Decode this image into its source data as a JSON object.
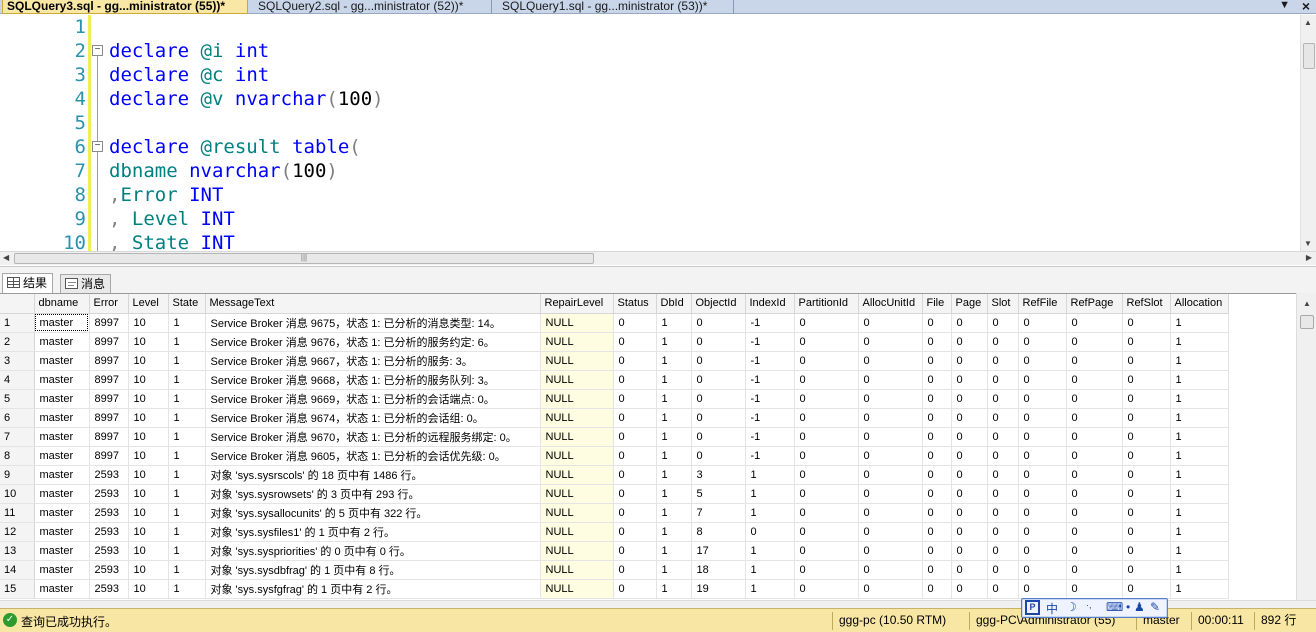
{
  "tabs": [
    {
      "label": "SQLQuery3.sql - gg...ministrator (55))*",
      "active": true
    },
    {
      "label": "SQLQuery2.sql - gg...ministrator (52))*",
      "active": false
    },
    {
      "label": "SQLQuery1.sql - gg...ministrator (53))*",
      "active": false
    }
  ],
  "tabbar": {
    "menu_glyph": "▼",
    "close_glyph": "×"
  },
  "editor": {
    "line_numbers": [
      "1",
      "2",
      "3",
      "4",
      "5",
      "6",
      "7",
      "8",
      "9",
      "10"
    ],
    "code": {
      "l2": {
        "kw": "declare",
        "var": "@i",
        "type": "int"
      },
      "l3": {
        "kw": "declare",
        "var": "@c",
        "type": "int"
      },
      "l4": {
        "kw": "declare",
        "var": "@v",
        "type": "nvarchar",
        "paren_open": "(",
        "num": "100",
        "paren_close": ")"
      },
      "l6": {
        "kw": "declare",
        "var": "@result",
        "type": "table",
        "paren_open": "("
      },
      "l7": {
        "col": "dbname",
        "type": "nvarchar",
        "paren_open": "(",
        "num": "100",
        "paren_close": ")"
      },
      "l8": {
        "comma": ",",
        "col": "Error",
        "type": "INT"
      },
      "l9": {
        "comma": ",",
        "col": " Level",
        "type": "INT"
      },
      "l10": {
        "comma": ",",
        "col": " State",
        "type": "INT"
      }
    },
    "fold_glyph": "−"
  },
  "results_tabs": [
    {
      "label": "结果",
      "active": true
    },
    {
      "label": "消息",
      "active": false
    }
  ],
  "grid": {
    "columns": [
      "dbname",
      "Error",
      "Level",
      "State",
      "MessageText",
      "RepairLevel",
      "Status",
      "DbId",
      "ObjectId",
      "IndexId",
      "PartitionId",
      "AllocUnitId",
      "File",
      "Page",
      "Slot",
      "RefFile",
      "RefPage",
      "RefSlot",
      "Allocation"
    ],
    "rows": [
      [
        "1",
        "master",
        "8997",
        "10",
        "1",
        "Service Broker 消息 9675，状态 1: 已分析的消息类型: 14。",
        "NULL",
        "0",
        "1",
        "0",
        "-1",
        "0",
        "0",
        "0",
        "0",
        "0",
        "0",
        "0",
        "0",
        "1"
      ],
      [
        "2",
        "master",
        "8997",
        "10",
        "1",
        "Service Broker 消息 9676，状态 1: 已分析的服务约定: 6。",
        "NULL",
        "0",
        "1",
        "0",
        "-1",
        "0",
        "0",
        "0",
        "0",
        "0",
        "0",
        "0",
        "0",
        "1"
      ],
      [
        "3",
        "master",
        "8997",
        "10",
        "1",
        "Service Broker 消息 9667，状态 1: 已分析的服务: 3。",
        "NULL",
        "0",
        "1",
        "0",
        "-1",
        "0",
        "0",
        "0",
        "0",
        "0",
        "0",
        "0",
        "0",
        "1"
      ],
      [
        "4",
        "master",
        "8997",
        "10",
        "1",
        "Service Broker 消息 9668，状态 1: 已分析的服务队列: 3。",
        "NULL",
        "0",
        "1",
        "0",
        "-1",
        "0",
        "0",
        "0",
        "0",
        "0",
        "0",
        "0",
        "0",
        "1"
      ],
      [
        "5",
        "master",
        "8997",
        "10",
        "1",
        "Service Broker 消息 9669，状态 1: 已分析的会话端点: 0。",
        "NULL",
        "0",
        "1",
        "0",
        "-1",
        "0",
        "0",
        "0",
        "0",
        "0",
        "0",
        "0",
        "0",
        "1"
      ],
      [
        "6",
        "master",
        "8997",
        "10",
        "1",
        "Service Broker 消息 9674，状态 1: 已分析的会话组: 0。",
        "NULL",
        "0",
        "1",
        "0",
        "-1",
        "0",
        "0",
        "0",
        "0",
        "0",
        "0",
        "0",
        "0",
        "1"
      ],
      [
        "7",
        "master",
        "8997",
        "10",
        "1",
        "Service Broker 消息 9670，状态 1: 已分析的远程服务绑定: 0。",
        "NULL",
        "0",
        "1",
        "0",
        "-1",
        "0",
        "0",
        "0",
        "0",
        "0",
        "0",
        "0",
        "0",
        "1"
      ],
      [
        "8",
        "master",
        "8997",
        "10",
        "1",
        "Service Broker 消息 9605，状态 1: 已分析的会话优先级: 0。",
        "NULL",
        "0",
        "1",
        "0",
        "-1",
        "0",
        "0",
        "0",
        "0",
        "0",
        "0",
        "0",
        "0",
        "1"
      ],
      [
        "9",
        "master",
        "2593",
        "10",
        "1",
        "对象 'sys.sysrscols' 的 18 页中有 1486 行。",
        "NULL",
        "0",
        "1",
        "3",
        "1",
        "0",
        "0",
        "0",
        "0",
        "0",
        "0",
        "0",
        "0",
        "1"
      ],
      [
        "10",
        "master",
        "2593",
        "10",
        "1",
        "对象 'sys.sysrowsets' 的 3 页中有 293 行。",
        "NULL",
        "0",
        "1",
        "5",
        "1",
        "0",
        "0",
        "0",
        "0",
        "0",
        "0",
        "0",
        "0",
        "1"
      ],
      [
        "11",
        "master",
        "2593",
        "10",
        "1",
        "对象 'sys.sysallocunits' 的 5 页中有 322 行。",
        "NULL",
        "0",
        "1",
        "7",
        "1",
        "0",
        "0",
        "0",
        "0",
        "0",
        "0",
        "0",
        "0",
        "1"
      ],
      [
        "12",
        "master",
        "2593",
        "10",
        "1",
        "对象 'sys.sysfiles1' 的 1 页中有 2 行。",
        "NULL",
        "0",
        "1",
        "8",
        "0",
        "0",
        "0",
        "0",
        "0",
        "0",
        "0",
        "0",
        "0",
        "1"
      ],
      [
        "13",
        "master",
        "2593",
        "10",
        "1",
        "对象 'sys.syspriorities' 的 0 页中有 0 行。",
        "NULL",
        "0",
        "1",
        "17",
        "1",
        "0",
        "0",
        "0",
        "0",
        "0",
        "0",
        "0",
        "0",
        "1"
      ],
      [
        "14",
        "master",
        "2593",
        "10",
        "1",
        "对象 'sys.sysdbfrag' 的 1 页中有 8 行。",
        "NULL",
        "0",
        "1",
        "18",
        "1",
        "0",
        "0",
        "0",
        "0",
        "0",
        "0",
        "0",
        "0",
        "1"
      ],
      [
        "15",
        "master",
        "2593",
        "10",
        "1",
        "对象 'sys.sysfgfrag' 的 1 页中有 2 行。",
        "NULL",
        "0",
        "1",
        "19",
        "1",
        "0",
        "0",
        "0",
        "0",
        "0",
        "0",
        "0",
        "0",
        "1"
      ]
    ]
  },
  "statusbar": {
    "message": "查询已成功执行。",
    "server": "ggg-pc (10.50 RTM)",
    "user": "ggg-PC\\Administrator (55)",
    "database": "master",
    "elapsed": "00:00:11",
    "rows": "892 行"
  },
  "ime": {
    "lang": "中"
  },
  "colors": {
    "active_tab": "#f9e7a6",
    "statusbar": "#f8e7a4",
    "keyword": "#0000ff",
    "variable": "#008080",
    "null_cell": "#fffde1"
  }
}
